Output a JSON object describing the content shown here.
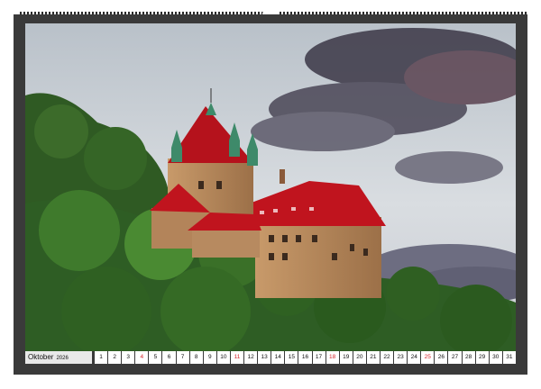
{
  "calendar": {
    "month": "Oktober",
    "year": "2026",
    "days": [
      "1",
      "2",
      "3",
      "4",
      "5",
      "6",
      "7",
      "8",
      "9",
      "10",
      "11",
      "12",
      "13",
      "14",
      "15",
      "16",
      "17",
      "18",
      "19",
      "20",
      "21",
      "22",
      "23",
      "24",
      "25",
      "26",
      "27",
      "28",
      "29",
      "30",
      "31"
    ],
    "sunday_days": [
      "4",
      "11",
      "18",
      "25"
    ],
    "sunday_color": "#d7262e"
  },
  "photo": {
    "subject": "castle-on-forested-hill",
    "roof_color": "#c0141e",
    "turret_color": "#3e8a6a"
  }
}
